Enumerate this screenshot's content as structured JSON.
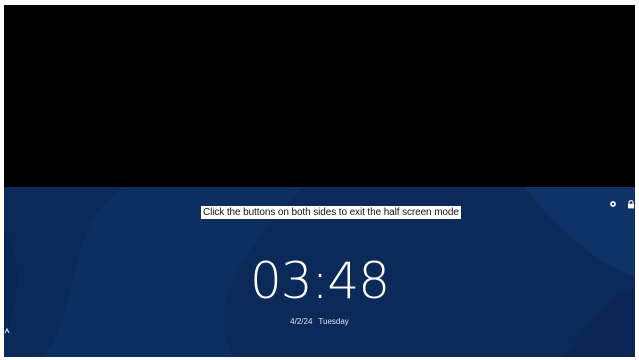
{
  "hint": {
    "text": "Click the buttons on both sides to exit the half screen mode"
  },
  "clock": {
    "time": "03:48",
    "date": "4/2/24",
    "weekday": "Tuesday"
  },
  "icons": {
    "settings": "gear-icon",
    "lock": "lock-icon",
    "left_arrow": "chevron-up-icon"
  },
  "colors": {
    "top_background": "#000000",
    "lock_background": "#0b2a5a",
    "text": "#ffffff"
  }
}
